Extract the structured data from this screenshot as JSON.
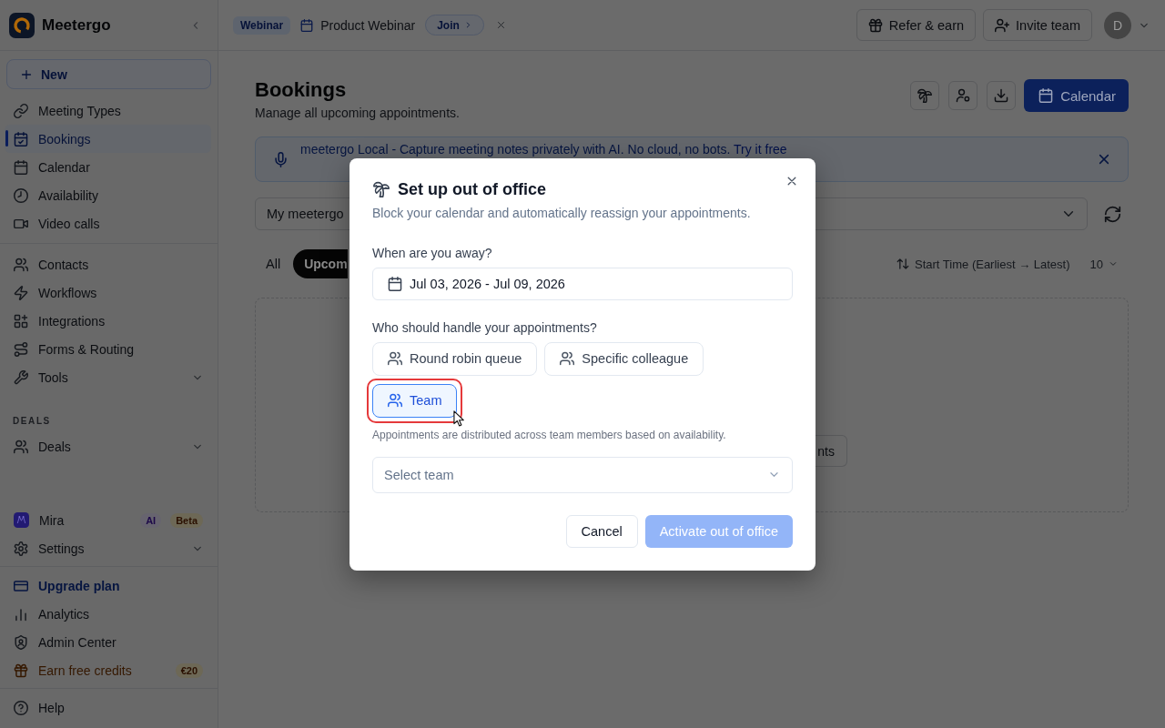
{
  "sidebar": {
    "brand": "Meetergo",
    "new_button": "New",
    "nav_groups": [
      {
        "items": [
          {
            "label": "Meeting Types",
            "kind": "link",
            "selected": false
          },
          {
            "label": "Bookings",
            "kind": "link",
            "selected": true
          },
          {
            "label": "Calendar",
            "kind": "link",
            "selected": false
          },
          {
            "label": "Availability",
            "kind": "link",
            "selected": false
          },
          {
            "label": "Video calls",
            "kind": "link",
            "selected": false
          }
        ]
      },
      {
        "items": [
          {
            "label": "Contacts",
            "kind": "link",
            "selected": false
          },
          {
            "label": "Workflows",
            "kind": "link",
            "selected": false
          },
          {
            "label": "Integrations",
            "kind": "link",
            "selected": false
          },
          {
            "label": "Forms & Routing",
            "kind": "link",
            "selected": false
          },
          {
            "label": "Tools",
            "kind": "group",
            "selected": false
          }
        ]
      },
      {
        "heading": "DEALS",
        "items": [
          {
            "label": "Deals",
            "kind": "group",
            "selected": false
          }
        ]
      }
    ],
    "bottom_groups": [
      {
        "items": [
          {
            "label": "Mira",
            "kind": "link",
            "selected": false,
            "badges": [
              {
                "label": "AI",
                "kind": "ai"
              },
              {
                "label": "Beta",
                "kind": "beta"
              }
            ]
          },
          {
            "label": "Settings",
            "kind": "group",
            "selected": false
          }
        ]
      },
      {
        "items": [
          {
            "label": "Upgrade plan",
            "kind": "upgrade",
            "selected": false
          },
          {
            "label": "Analytics",
            "kind": "link",
            "selected": false
          },
          {
            "label": "Admin Center",
            "kind": "link",
            "selected": false
          },
          {
            "label": "Earn free credits",
            "kind": "reward",
            "selected": false,
            "badges": [
              {
                "label": "€20",
                "kind": "credit"
              }
            ]
          }
        ]
      },
      {
        "items": [
          {
            "label": "Help",
            "kind": "link",
            "selected": false
          }
        ]
      }
    ]
  },
  "topbar": {
    "webinar": {
      "badge": "Webinar",
      "title": "Product Webinar",
      "join": "Join"
    },
    "actions": [
      "Refer & earn",
      "Invite team"
    ],
    "avatar": "D"
  },
  "page": {
    "title": "Bookings",
    "subtitle": "Manage all upcoming appointments.",
    "primary_button": "Calendar"
  },
  "banner": {
    "title": "meetergo Local",
    "text": "- Capture meeting notes privately with AI. No cloud, no bots.",
    "link": "Try it free"
  },
  "filters": {
    "source": "My meetergo",
    "tabs": [
      {
        "label": "All",
        "selected": false
      },
      {
        "label": "Upcom",
        "selected": true
      }
    ],
    "sort": "Start Time (Earliest → Latest)",
    "page_size": "10"
  },
  "empty_state": {
    "button": "nts"
  },
  "modal": {
    "title": "Set up out of office",
    "subtitle": "Block your calendar and automatically reassign your appointments.",
    "date_label": "When are you away?",
    "date_range": "Jul 03, 2026 - Jul 09, 2026",
    "handler_label": "Who should handle your appointments?",
    "options": [
      {
        "label": "Round robin queue",
        "selected": false,
        "highlighted": false
      },
      {
        "label": "Specific colleague",
        "selected": false,
        "highlighted": false
      },
      {
        "label": "Team",
        "selected": true,
        "highlighted": true
      }
    ],
    "hint": "Appointments are distributed across team members based on availability.",
    "team_select": {
      "placeholder": "Select team"
    },
    "buttons": [
      {
        "label": "Cancel",
        "kind": "secondary",
        "disabled": false
      },
      {
        "label": "Activate out of office",
        "kind": "primary",
        "disabled": true
      }
    ]
  }
}
